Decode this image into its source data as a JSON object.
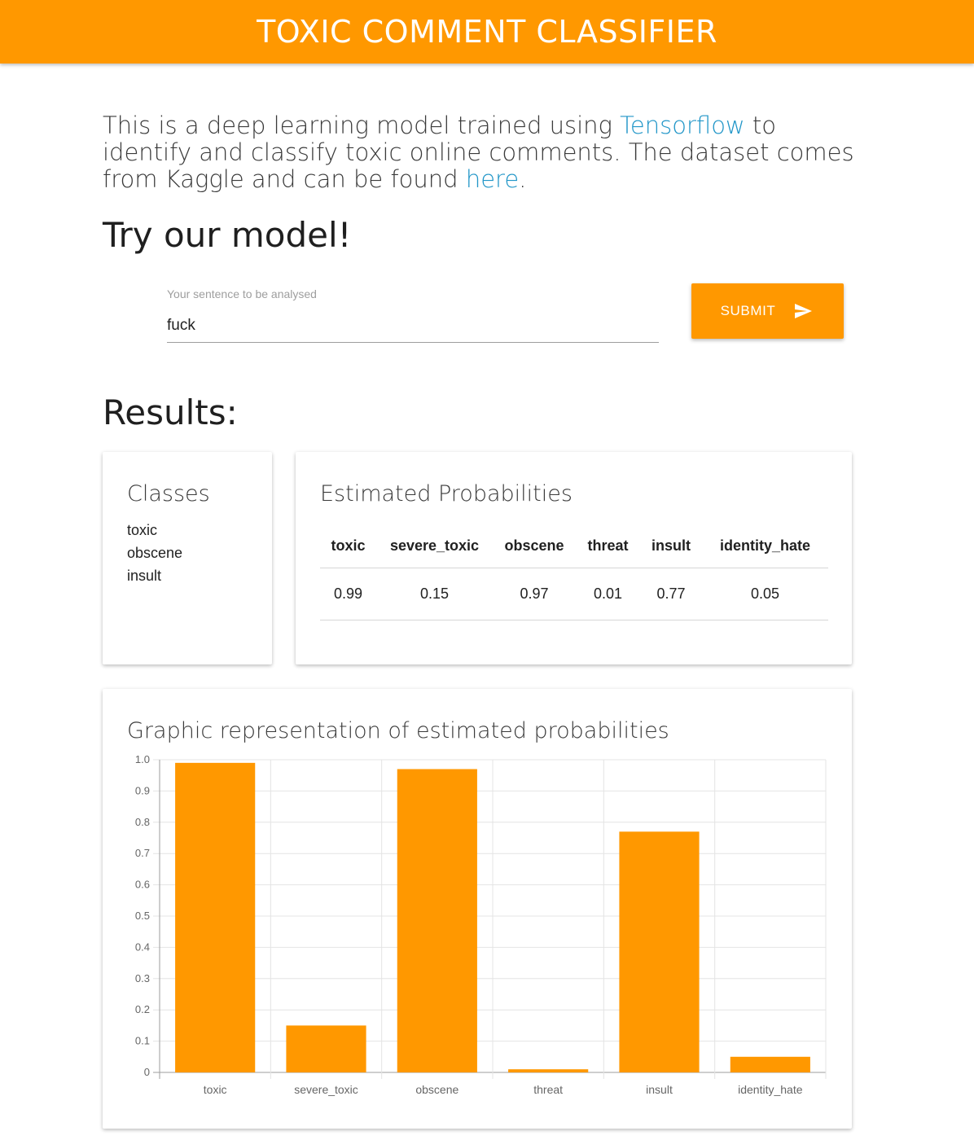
{
  "header": {
    "title": "TOXIC COMMENT CLASSIFIER",
    "color": "#ff9800"
  },
  "intro": {
    "text_before": "This is a deep learning model trained using ",
    "tensorflow_link": "Tensorflow",
    "text_middle": " to identify and classify toxic online comments. The dataset comes from Kaggle and can be found ",
    "here_link": "here",
    "text_after": "."
  },
  "try_section": {
    "title": "Try our model!",
    "input_label": "Your sentence to be analysed",
    "input_value": "fuck",
    "submit_label": "SUBMIT"
  },
  "results": {
    "title": "Results:",
    "classes_card": {
      "title": "Classes",
      "items": [
        "toxic",
        "obscene",
        "insult"
      ]
    },
    "probabilities_card": {
      "title": "Estimated Probabilities",
      "headers": [
        "toxic",
        "severe_toxic",
        "obscene",
        "threat",
        "insult",
        "identity_hate"
      ],
      "values": [
        "0.99",
        "0.15",
        "0.97",
        "0.01",
        "0.77",
        "0.05"
      ]
    },
    "chart_card": {
      "title": "Graphic representation of estimated probabilities"
    }
  },
  "chart_data": {
    "type": "bar",
    "categories": [
      "toxic",
      "severe_toxic",
      "obscene",
      "threat",
      "insult",
      "identity_hate"
    ],
    "values": [
      0.99,
      0.15,
      0.97,
      0.01,
      0.77,
      0.05
    ],
    "ylim": [
      0,
      1.0
    ],
    "yticks": [
      "0",
      "0.1",
      "0.2",
      "0.3",
      "0.4",
      "0.5",
      "0.6",
      "0.7",
      "0.8",
      "0.9",
      "1.0"
    ],
    "grid": true,
    "bar_color": "#ff9800",
    "title": "",
    "xlabel": "",
    "ylabel": ""
  }
}
